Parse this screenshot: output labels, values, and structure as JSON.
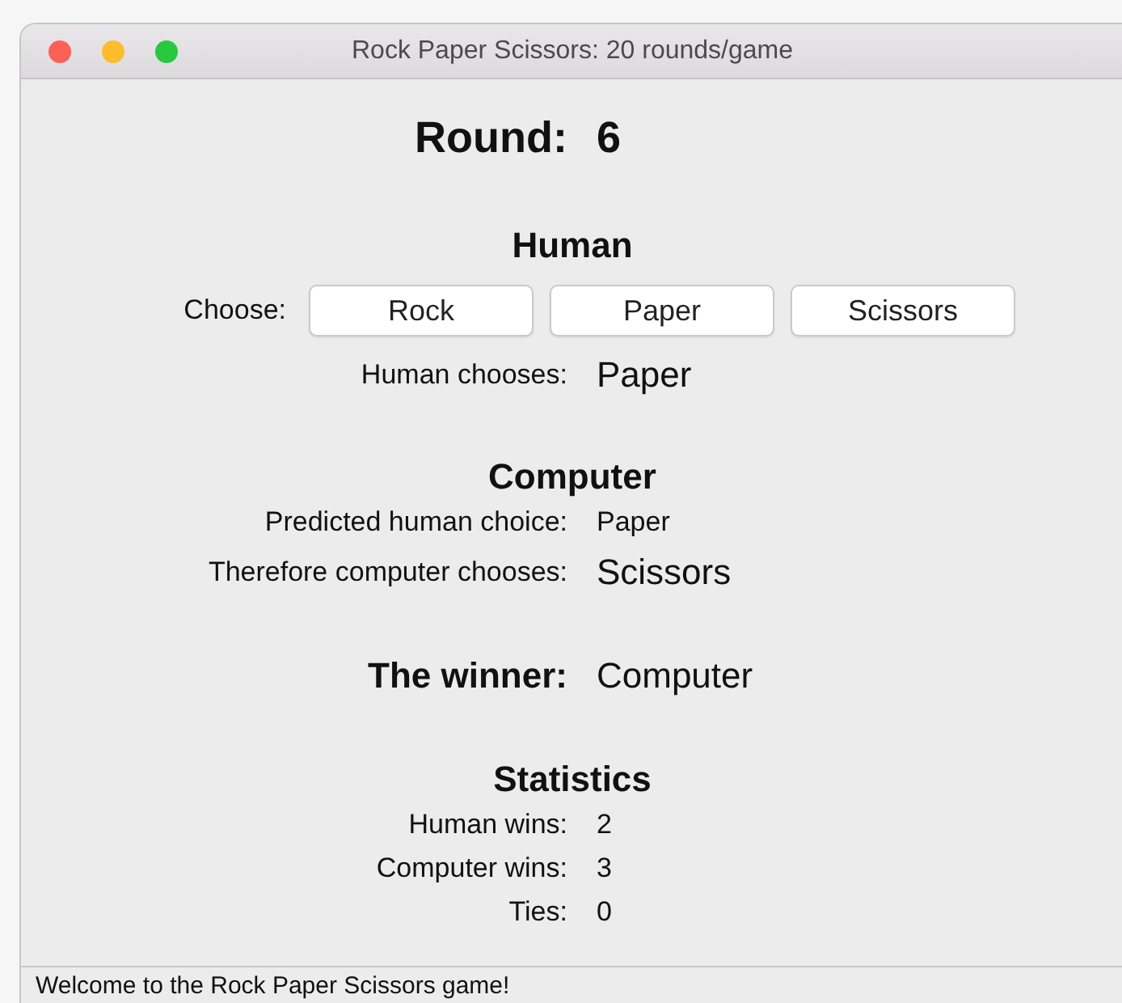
{
  "window": {
    "title": "Rock Paper Scissors: 20 rounds/game"
  },
  "round": {
    "label": "Round:",
    "value": "6"
  },
  "sections": [
    {
      "heading": "Human",
      "rows": [
        {
          "kind": "choose",
          "label": "Choose:",
          "buttons": [
            "Rock",
            "Paper",
            "Scissors"
          ]
        },
        {
          "kind": "result",
          "label": "Human chooses:",
          "value": "Paper"
        }
      ]
    },
    {
      "heading": "Computer",
      "rows": [
        {
          "kind": "info",
          "label": "Predicted human choice:",
          "value": "Paper"
        },
        {
          "kind": "result",
          "label": "Therefore computer chooses:",
          "value": "Scissors"
        }
      ]
    },
    {
      "rows": [
        {
          "kind": "winner",
          "label": "The winner:",
          "value": "Computer"
        }
      ]
    },
    {
      "heading": "Statistics",
      "rows": [
        {
          "kind": "info",
          "label": "Human wins:",
          "value": "2"
        },
        {
          "kind": "info",
          "label": "Computer wins:",
          "value": "3"
        },
        {
          "kind": "info",
          "label": "Ties:",
          "value": "0"
        }
      ]
    }
  ],
  "status_bar": "Welcome to the Rock Paper Scissors game!"
}
